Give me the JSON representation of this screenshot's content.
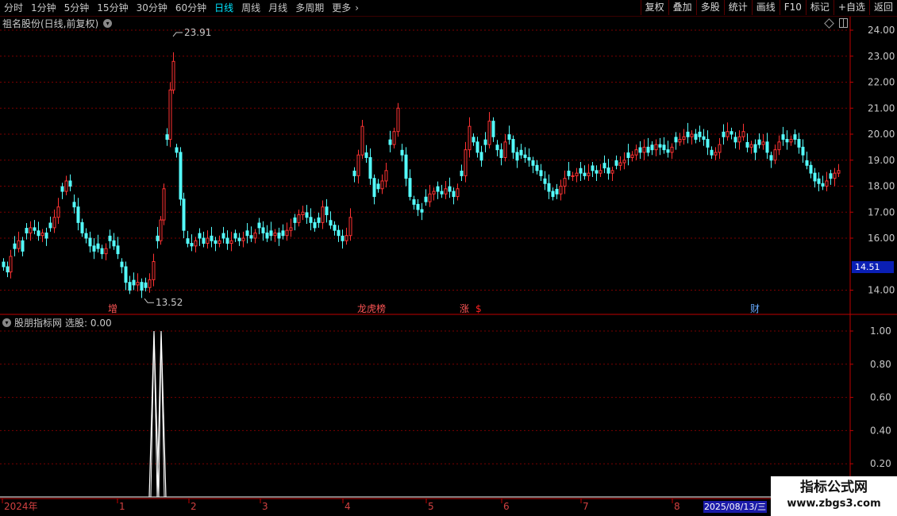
{
  "toolbar": {
    "periods": [
      "分时",
      "1分钟",
      "5分钟",
      "15分钟",
      "30分钟",
      "60分钟",
      "日线",
      "周线",
      "月线",
      "多周期",
      "更多"
    ],
    "active_period": "日线",
    "more_arrow": "›",
    "right_buttons": [
      "复权",
      "叠加",
      "多股",
      "统计",
      "画线",
      "F10",
      "标记",
      "+自选",
      "返回"
    ]
  },
  "main_chart": {
    "title": "祖名股份(日线,前复权)",
    "price_axis": [
      "24.00",
      "23.00",
      "22.00",
      "21.00",
      "20.00",
      "19.00",
      "18.00",
      "17.00",
      "16.00",
      "14.00"
    ],
    "high_label": "23.91",
    "low_label": "13.52",
    "current_price": "14.51",
    "event_markers": [
      {
        "label": "增",
        "color": "#ff5555"
      },
      {
        "label": "龙虎榜",
        "color": "#ff5555"
      },
      {
        "label": "涨",
        "color": "#ff5555"
      },
      {
        "label": "$",
        "color": "#ff2222"
      },
      {
        "label": "财",
        "color": "#66aaff"
      }
    ],
    "colors": {
      "up": "#ff3232",
      "down": "#54fcfc",
      "grid": "#7a0000"
    }
  },
  "indicator": {
    "name": "股朋指标网",
    "value_text": "选股: 0.00",
    "axis": [
      "1.00",
      "0.80",
      "0.60",
      "0.40",
      "0.20"
    ]
  },
  "date_axis": {
    "labels": [
      "2024年",
      "1",
      "2",
      "3",
      "4",
      "5",
      "6",
      "7",
      "8"
    ],
    "cursor_date": "2025/08/13/三"
  },
  "watermark": {
    "title": "指标公式网",
    "url": "www.zbgs3.com"
  }
}
